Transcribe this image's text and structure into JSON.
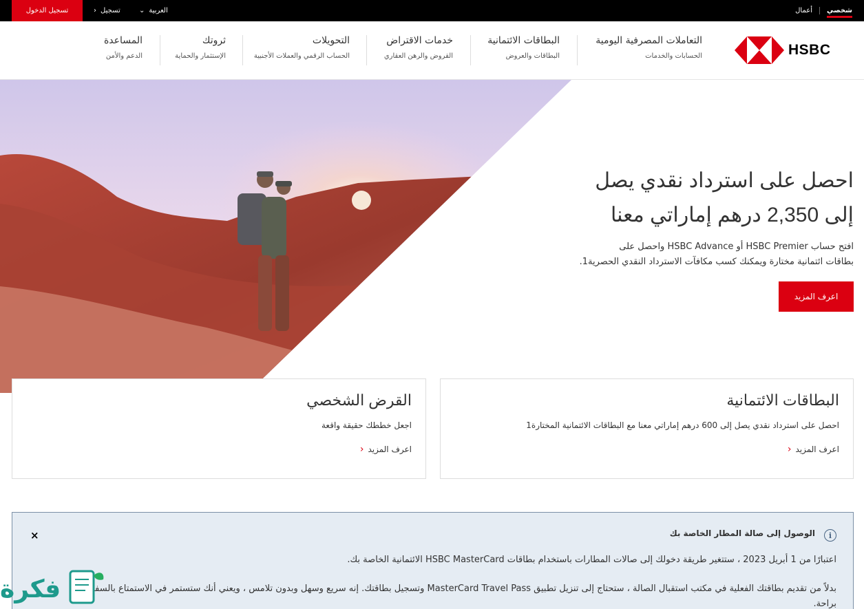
{
  "topbar": {
    "login": "تسجيل الدخول",
    "register": "تسجيل",
    "language": "العربية",
    "business": "أعمال",
    "personal": "شخصي"
  },
  "brand": {
    "name": "HSBC",
    "red": "#db0011"
  },
  "nav": [
    {
      "title": "التعاملات المصرفية اليومية",
      "sub": "الحسابات والخدمات"
    },
    {
      "title": "البطاقات الائتمانية",
      "sub": "البطاقات والعروض"
    },
    {
      "title": "خدمات الاقتراض",
      "sub": "القروض والرهن العقاري"
    },
    {
      "title": "التحويلات",
      "sub": "الحساب الرقمي والعملات الأجنبية"
    },
    {
      "title": "ثروتك",
      "sub": "الإستثمار والحماية"
    },
    {
      "title": "المساعدة",
      "sub": "الدعم والأمن"
    }
  ],
  "hero": {
    "line1": "احصل على استرداد نقدي يصل",
    "line2": "إلى 2,350 درهم إماراتي معنا",
    "desc1": "افتح حساب HSBC Premier أو HSBC Advance واحصل على",
    "desc2": "بطاقات ائتمانية مختارة ويمكنك كسب مكافآت الاسترداد النقدي الحصرية1.",
    "button": "اعرف المزيد"
  },
  "cards": [
    {
      "title": "البطاقات الائتمانية",
      "desc": "احصل على استرداد نقدي يصل إلى 600 درهم إماراتي معنا مع البطاقات الائتمانية المختارة1",
      "link": "اعرف المزيد"
    },
    {
      "title": "القرض الشخصي",
      "desc": "اجعل خططك حقيقة واقعة",
      "link": "اعرف المزيد"
    }
  ],
  "notice": {
    "title": "الوصول إلى صالة المطار الخاصة بك",
    "p1": "اعتبارًا من 1 أبريل 2023 ، ستتغير طريقة دخولك إلى صالات المطارات باستخدام بطاقات HSBC MasterCard الائتمانية الخاصة بك.",
    "p2": "بدلاً من تقديم بطاقتك الفعلية في مكتب استقبال الصالة ، ستحتاج إلى تنزيل تطبيق MasterCard Travel Pass وتسجيل بطاقتك. إنه سريع وسهل وبدون تلامس ، ويعني أنك ستستمر في الاستمتاع بالسفر براحة.",
    "close": "×"
  },
  "watermark": {
    "text": "فكرة"
  }
}
